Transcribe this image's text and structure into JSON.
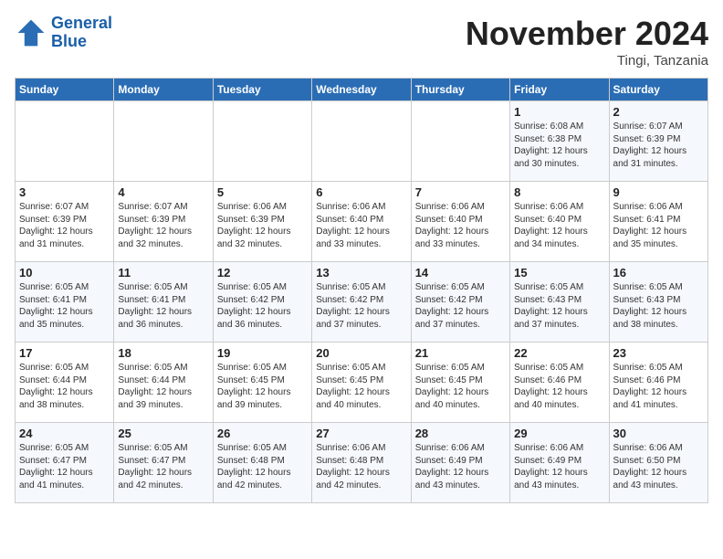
{
  "header": {
    "logo_line1": "General",
    "logo_line2": "Blue",
    "month": "November 2024",
    "location": "Tingi, Tanzania"
  },
  "days_of_week": [
    "Sunday",
    "Monday",
    "Tuesday",
    "Wednesday",
    "Thursday",
    "Friday",
    "Saturday"
  ],
  "weeks": [
    [
      {
        "day": "",
        "text": ""
      },
      {
        "day": "",
        "text": ""
      },
      {
        "day": "",
        "text": ""
      },
      {
        "day": "",
        "text": ""
      },
      {
        "day": "",
        "text": ""
      },
      {
        "day": "1",
        "text": "Sunrise: 6:08 AM\nSunset: 6:38 PM\nDaylight: 12 hours and 30 minutes."
      },
      {
        "day": "2",
        "text": "Sunrise: 6:07 AM\nSunset: 6:39 PM\nDaylight: 12 hours and 31 minutes."
      }
    ],
    [
      {
        "day": "3",
        "text": "Sunrise: 6:07 AM\nSunset: 6:39 PM\nDaylight: 12 hours and 31 minutes."
      },
      {
        "day": "4",
        "text": "Sunrise: 6:07 AM\nSunset: 6:39 PM\nDaylight: 12 hours and 32 minutes."
      },
      {
        "day": "5",
        "text": "Sunrise: 6:06 AM\nSunset: 6:39 PM\nDaylight: 12 hours and 32 minutes."
      },
      {
        "day": "6",
        "text": "Sunrise: 6:06 AM\nSunset: 6:40 PM\nDaylight: 12 hours and 33 minutes."
      },
      {
        "day": "7",
        "text": "Sunrise: 6:06 AM\nSunset: 6:40 PM\nDaylight: 12 hours and 33 minutes."
      },
      {
        "day": "8",
        "text": "Sunrise: 6:06 AM\nSunset: 6:40 PM\nDaylight: 12 hours and 34 minutes."
      },
      {
        "day": "9",
        "text": "Sunrise: 6:06 AM\nSunset: 6:41 PM\nDaylight: 12 hours and 35 minutes."
      }
    ],
    [
      {
        "day": "10",
        "text": "Sunrise: 6:05 AM\nSunset: 6:41 PM\nDaylight: 12 hours and 35 minutes."
      },
      {
        "day": "11",
        "text": "Sunrise: 6:05 AM\nSunset: 6:41 PM\nDaylight: 12 hours and 36 minutes."
      },
      {
        "day": "12",
        "text": "Sunrise: 6:05 AM\nSunset: 6:42 PM\nDaylight: 12 hours and 36 minutes."
      },
      {
        "day": "13",
        "text": "Sunrise: 6:05 AM\nSunset: 6:42 PM\nDaylight: 12 hours and 37 minutes."
      },
      {
        "day": "14",
        "text": "Sunrise: 6:05 AM\nSunset: 6:42 PM\nDaylight: 12 hours and 37 minutes."
      },
      {
        "day": "15",
        "text": "Sunrise: 6:05 AM\nSunset: 6:43 PM\nDaylight: 12 hours and 37 minutes."
      },
      {
        "day": "16",
        "text": "Sunrise: 6:05 AM\nSunset: 6:43 PM\nDaylight: 12 hours and 38 minutes."
      }
    ],
    [
      {
        "day": "17",
        "text": "Sunrise: 6:05 AM\nSunset: 6:44 PM\nDaylight: 12 hours and 38 minutes."
      },
      {
        "day": "18",
        "text": "Sunrise: 6:05 AM\nSunset: 6:44 PM\nDaylight: 12 hours and 39 minutes."
      },
      {
        "day": "19",
        "text": "Sunrise: 6:05 AM\nSunset: 6:45 PM\nDaylight: 12 hours and 39 minutes."
      },
      {
        "day": "20",
        "text": "Sunrise: 6:05 AM\nSunset: 6:45 PM\nDaylight: 12 hours and 40 minutes."
      },
      {
        "day": "21",
        "text": "Sunrise: 6:05 AM\nSunset: 6:45 PM\nDaylight: 12 hours and 40 minutes."
      },
      {
        "day": "22",
        "text": "Sunrise: 6:05 AM\nSunset: 6:46 PM\nDaylight: 12 hours and 40 minutes."
      },
      {
        "day": "23",
        "text": "Sunrise: 6:05 AM\nSunset: 6:46 PM\nDaylight: 12 hours and 41 minutes."
      }
    ],
    [
      {
        "day": "24",
        "text": "Sunrise: 6:05 AM\nSunset: 6:47 PM\nDaylight: 12 hours and 41 minutes."
      },
      {
        "day": "25",
        "text": "Sunrise: 6:05 AM\nSunset: 6:47 PM\nDaylight: 12 hours and 42 minutes."
      },
      {
        "day": "26",
        "text": "Sunrise: 6:05 AM\nSunset: 6:48 PM\nDaylight: 12 hours and 42 minutes."
      },
      {
        "day": "27",
        "text": "Sunrise: 6:06 AM\nSunset: 6:48 PM\nDaylight: 12 hours and 42 minutes."
      },
      {
        "day": "28",
        "text": "Sunrise: 6:06 AM\nSunset: 6:49 PM\nDaylight: 12 hours and 43 minutes."
      },
      {
        "day": "29",
        "text": "Sunrise: 6:06 AM\nSunset: 6:49 PM\nDaylight: 12 hours and 43 minutes."
      },
      {
        "day": "30",
        "text": "Sunrise: 6:06 AM\nSunset: 6:50 PM\nDaylight: 12 hours and 43 minutes."
      }
    ]
  ]
}
